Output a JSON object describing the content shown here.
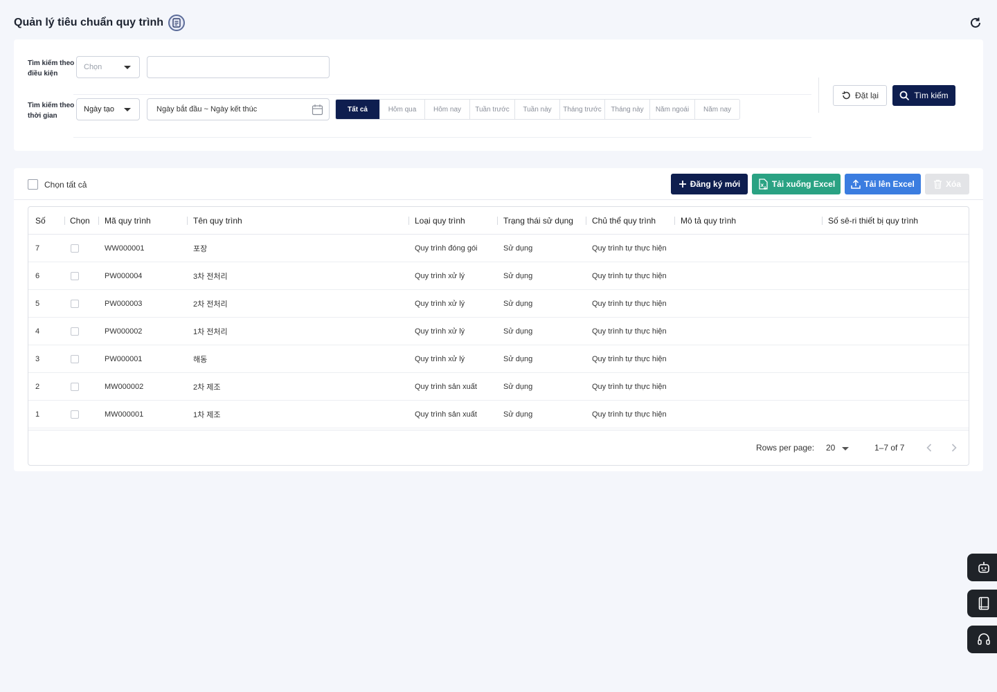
{
  "header": {
    "title": "Quản lý tiêu chuẩn quy trình",
    "title_icon": "document-icon",
    "refresh_icon": "refresh-icon"
  },
  "search": {
    "condition_label": "Tìm kiếm theo điều kiện",
    "condition_select": "Chọn",
    "condition_input_value": "",
    "time_label": "Tìm kiếm theo thời gian",
    "time_select": "Ngày tạo",
    "date_range_placeholder": "Ngày bắt đầu ~ Ngày kết thúc",
    "quick_ranges": [
      {
        "label": "Tất cả",
        "active": true
      },
      {
        "label": "Hôm qua",
        "active": false
      },
      {
        "label": "Hôm nay",
        "active": false
      },
      {
        "label": "Tuần trước",
        "active": false
      },
      {
        "label": "Tuần này",
        "active": false
      },
      {
        "label": "Tháng trước",
        "active": false
      },
      {
        "label": "Tháng này",
        "active": false
      },
      {
        "label": "Năm ngoái",
        "active": false
      },
      {
        "label": "Năm nay",
        "active": false
      }
    ],
    "reset_label": "Đặt lại",
    "search_label": "Tìm kiếm"
  },
  "toolbar": {
    "select_all_label": "Chọn tất cả",
    "new_label": "Đăng ký mới",
    "download_label": "Tải xuống Excel",
    "upload_label": "Tải lên Excel",
    "delete_label": "Xóa"
  },
  "table": {
    "columns": [
      "Số",
      "Chọn",
      "Mã quy trình",
      "Tên quy trình",
      "Loại quy trình",
      "Trạng thái sử dụng",
      "Chủ thể quy trình",
      "Mô tả quy trình",
      "Số sê-ri thiết bị quy trình"
    ],
    "rows": [
      {
        "no": "7",
        "code": "WW000001",
        "name": "포장",
        "type": "Quy trình đóng gói",
        "status": "Sử dụng",
        "owner": "Quy trình tự thực hiện",
        "desc": "",
        "serial": ""
      },
      {
        "no": "6",
        "code": "PW000004",
        "name": "3차 전처리",
        "type": "Quy trình xử lý",
        "status": "Sử dụng",
        "owner": "Quy trình tự thực hiện",
        "desc": "",
        "serial": ""
      },
      {
        "no": "5",
        "code": "PW000003",
        "name": "2차 전처리",
        "type": "Quy trình xử lý",
        "status": "Sử dụng",
        "owner": "Quy trình tự thực hiện",
        "desc": "",
        "serial": ""
      },
      {
        "no": "4",
        "code": "PW000002",
        "name": "1차 전처리",
        "type": "Quy trình xử lý",
        "status": "Sử dụng",
        "owner": "Quy trình tự thực hiện",
        "desc": "",
        "serial": ""
      },
      {
        "no": "3",
        "code": "PW000001",
        "name": "해동",
        "type": "Quy trình xử lý",
        "status": "Sử dụng",
        "owner": "Quy trình tự thực hiện",
        "desc": "",
        "serial": ""
      },
      {
        "no": "2",
        "code": "MW000002",
        "name": "2차 제조",
        "type": "Quy trình sản xuất",
        "status": "Sử dụng",
        "owner": "Quy trình tự thực hiện",
        "desc": "",
        "serial": ""
      },
      {
        "no": "1",
        "code": "MW000001",
        "name": "1차 제조",
        "type": "Quy trình sản xuất",
        "status": "Sử dụng",
        "owner": "Quy trình tự thực hiện",
        "desc": "",
        "serial": ""
      }
    ]
  },
  "pagination": {
    "rows_per_page_label": "Rows per page:",
    "rows_per_page": "20",
    "range": "1–7 of 7"
  },
  "floating": [
    "robot-icon",
    "book-icon",
    "headset-icon"
  ],
  "colors": {
    "primary": "#0e1e4f",
    "excel_download": "#2aa283",
    "excel_upload": "#3b7de0",
    "disabled": "#e3e4e7"
  }
}
